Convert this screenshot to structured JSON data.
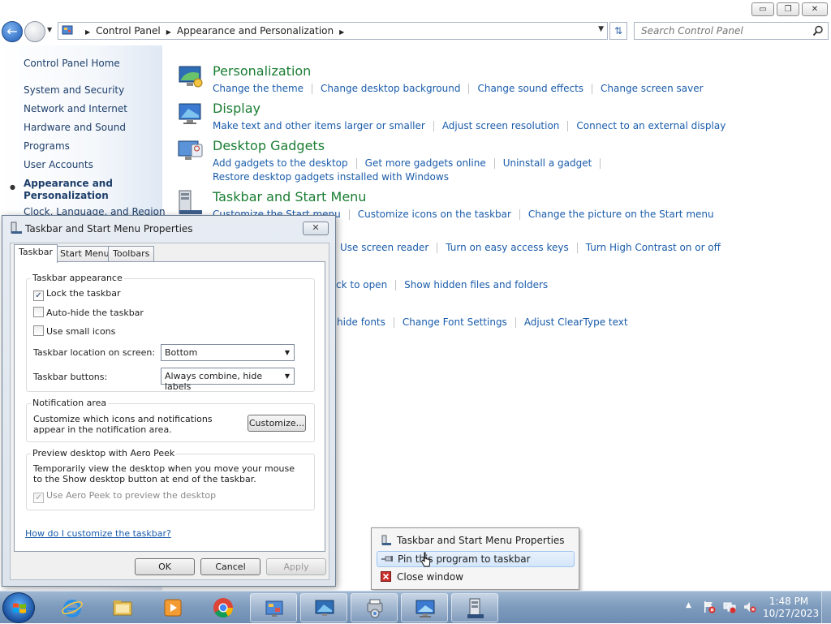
{
  "explorer": {
    "address": {
      "crumbs": [
        "Control Panel",
        "Appearance and Personalization"
      ]
    },
    "search": {
      "placeholder": "Search Control Panel"
    },
    "caption_buttons": {
      "minimize": "▭",
      "restore": "❐",
      "close": "✕"
    }
  },
  "leftpane": {
    "home": "Control Panel Home",
    "items": [
      "System and Security",
      "Network and Internet",
      "Hardware and Sound",
      "Programs",
      "User Accounts"
    ],
    "active": "Appearance and Personalization",
    "cut_item": "Clock, Language, and Region"
  },
  "categories": [
    {
      "title": "Personalization",
      "links": [
        "Change the theme",
        "Change desktop background",
        "Change sound effects",
        "Change screen saver"
      ]
    },
    {
      "title": "Display",
      "links": [
        "Make text and other items larger or smaller",
        "Adjust screen resolution",
        "Connect to an external display"
      ]
    },
    {
      "title": "Desktop Gadgets",
      "links": [
        "Add gadgets to the desktop",
        "Get more gadgets online",
        "Uninstall a gadget"
      ],
      "links2": [
        "Restore desktop gadgets installed with Windows"
      ]
    },
    {
      "title": "Taskbar and Start Menu",
      "links": [
        "Customize the Start menu",
        "Customize icons on the taskbar",
        "Change the picture on the Start menu"
      ]
    }
  ],
  "partial_rows": [
    [
      "Use screen reader",
      "Turn on easy access keys",
      "Turn High Contrast on or off"
    ],
    [
      "ck to open",
      "Show hidden files and folders"
    ],
    [
      "hide fonts",
      "Change Font Settings",
      "Adjust ClearType text"
    ]
  ],
  "dialog": {
    "title": "Taskbar and Start Menu Properties",
    "tabs": [
      "Taskbar",
      "Start Menu",
      "Toolbars"
    ],
    "appearance": {
      "legend": "Taskbar appearance",
      "lock": {
        "label": "Lock the taskbar",
        "checked": true
      },
      "autohide": {
        "label": "Auto-hide the taskbar",
        "checked": false
      },
      "small": {
        "label": "Use small icons",
        "checked": false
      },
      "location_label": "Taskbar location on screen:",
      "location_value": "Bottom",
      "buttons_label": "Taskbar buttons:",
      "buttons_value": "Always combine, hide labels"
    },
    "notification": {
      "legend": "Notification area",
      "desc": "Customize which icons and notifications appear in the notification area.",
      "button": "Customize..."
    },
    "peek": {
      "legend": "Preview desktop with Aero Peek",
      "desc": "Temporarily view the desktop when you move your mouse to the Show desktop button at end of the taskbar.",
      "checkbox": "Use Aero Peek to preview the desktop",
      "checked": true
    },
    "help_link": "How do I customize the taskbar?",
    "ok": "OK",
    "cancel": "Cancel",
    "apply": "Apply"
  },
  "context_menu": {
    "items": [
      "Taskbar and Start Menu Properties",
      "Pin this program to taskbar",
      "Close window"
    ]
  },
  "taskbar": {
    "clock": {
      "time": "1:48 PM",
      "date": "10/27/2023"
    }
  },
  "colors": {
    "link": "#1a5caa",
    "category_title": "#1a7d33",
    "taskbar": "#7f9cbe"
  }
}
